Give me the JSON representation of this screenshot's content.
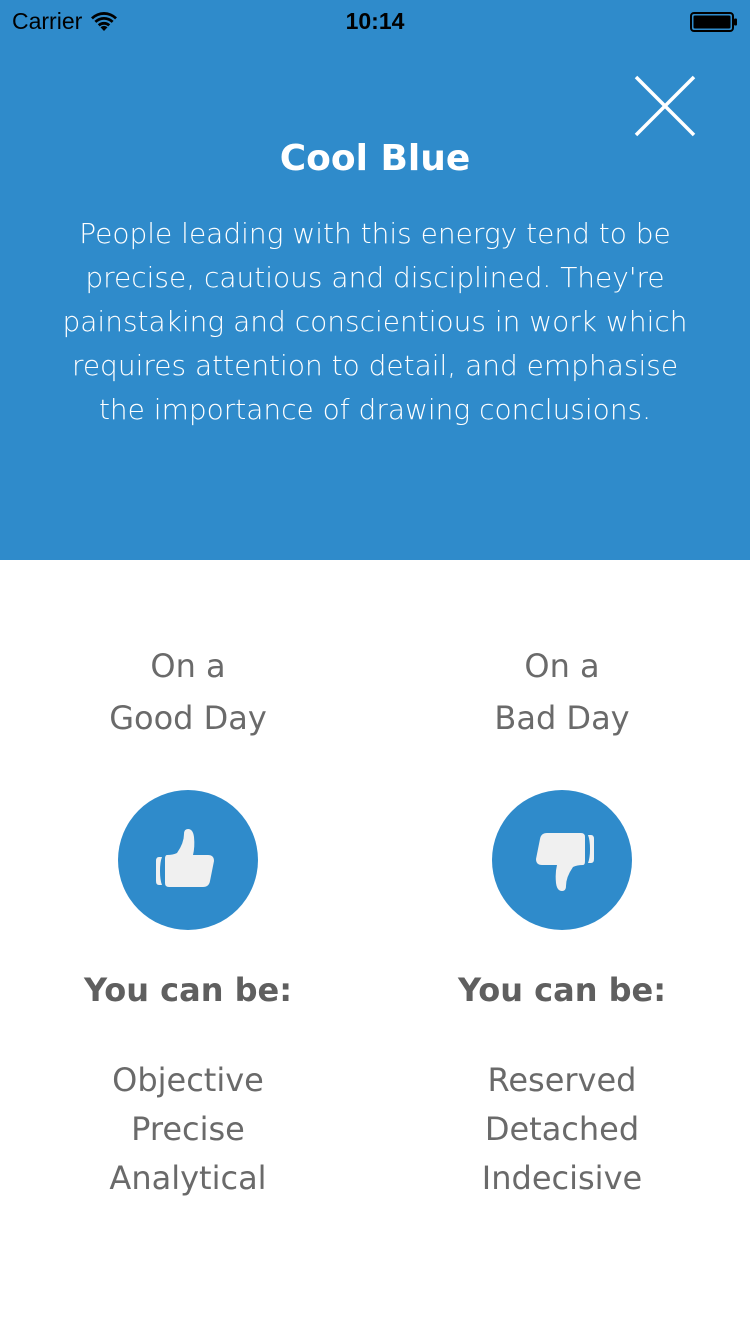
{
  "status_bar": {
    "carrier": "Carrier",
    "time": "10:14"
  },
  "header": {
    "title": "Cool Blue",
    "description": "People leading with this energy tend to be precise, cautious and disciplined. They're painstaking and conscientious in work which requires attention to detail, and emphasise the importance of drawing conclusions.",
    "background_color": "#2f8bcb"
  },
  "good_day": {
    "heading_line1": "On a",
    "heading_line2": "Good Day",
    "icon": "thumbs-up-icon",
    "subheading": "You can be:",
    "traits": [
      "Objective",
      "Precise",
      "Analytical"
    ]
  },
  "bad_day": {
    "heading_line1": "On a",
    "heading_line2": "Bad Day",
    "icon": "thumbs-down-icon",
    "subheading": "You can be:",
    "traits": [
      "Reserved",
      "Detached",
      "Indecisive"
    ]
  },
  "colors": {
    "accent": "#2f8bcb",
    "icon_fill": "#f0f0f0",
    "text_gray": "#666666"
  }
}
